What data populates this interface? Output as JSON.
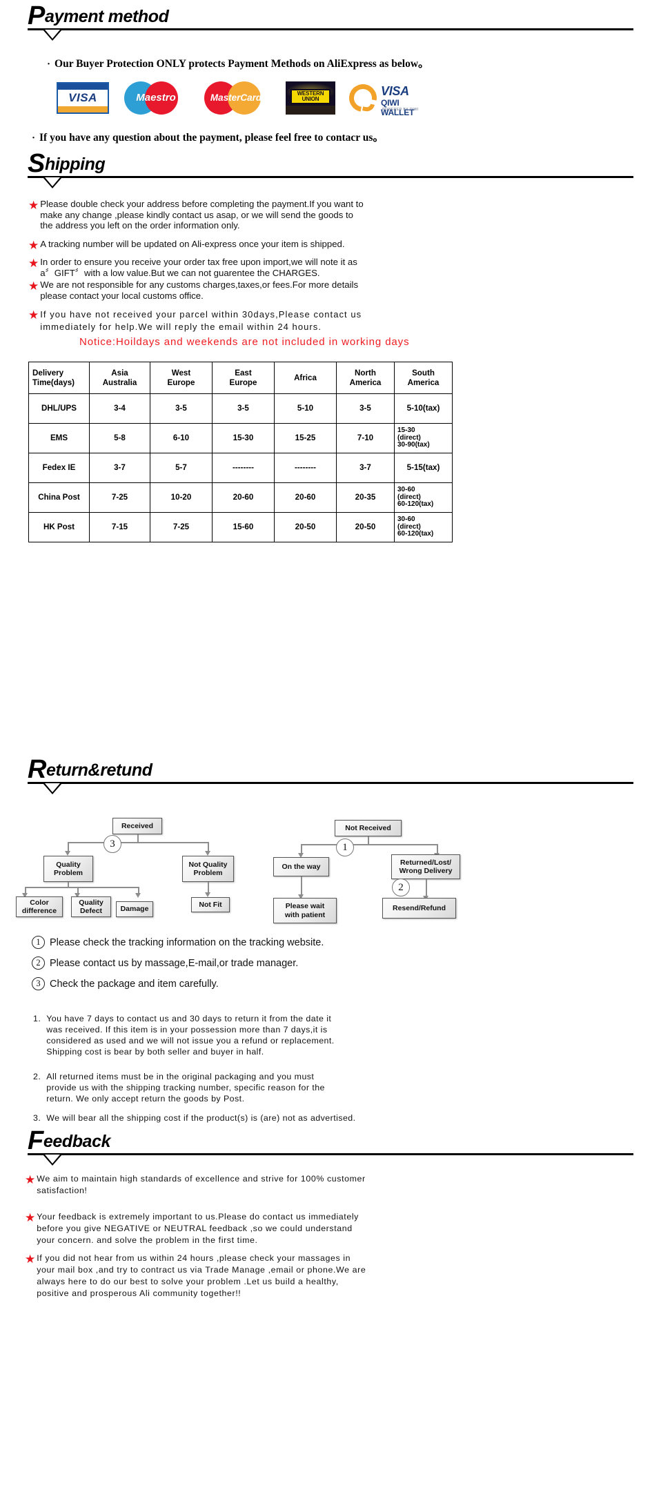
{
  "payment": {
    "heading_cap": "P",
    "heading_rest": "ayment method",
    "bullet_1": "Our Buyer Protection ONLY protects Payment Methods on AliExpress as below。",
    "bullet_2": "If you have any question about the payment, please feel free to contacr us。",
    "logos": [
      {
        "name": "visa-logo",
        "text": "VISA"
      },
      {
        "name": "maestro-logo",
        "text": "Maestro"
      },
      {
        "name": "mastercard-logo",
        "text": "MasterCard"
      },
      {
        "name": "western-union-logo",
        "line1": "WESTERN",
        "line2": "UNION"
      },
      {
        "name": "qiwi-wallet-logo",
        "visa": "VISA",
        "wallet": "QIWI WALLET",
        "powered": "POWERED BY QIWI"
      }
    ]
  },
  "shipping": {
    "heading_cap": "S",
    "heading_rest": "hipping",
    "bullets": [
      "Please double check your address before completing the payment.If you want to\nmake any change ,please kindly contact us asap, or we will send the goods to\nthe address you left on the order information only.",
      "A tracking number will be updated on Ali-express once your item is shipped.",
      "In order to ensure you receive your order tax free upon import,we will note it as\n a〞GIFT〞with a low value.But we can not guarentee the CHARGES.",
      "We are not responsible for any customs charges,taxes,or fees.For more details\n please contact your local customs office.",
      "If you have not received your parcel within 30days,Please contact us\nimmediately for help.We will reply the email within 24 hours."
    ],
    "notice": "Notice:Hoildays and weekends are not included in working days"
  },
  "shipping_table": {
    "headers": [
      "Delivery\nTime(days)",
      "Asia\nAustralia",
      "West\nEurope",
      "East\nEurope",
      "Africa",
      "North\nAmerica",
      "South\nAmerica"
    ],
    "rows": [
      {
        "method": "DHL/UPS",
        "cells": [
          "3-4",
          "3-5",
          "3-5",
          "5-10",
          "3-5",
          "5-10(tax)"
        ],
        "last_small": false
      },
      {
        "method": "EMS",
        "cells": [
          "5-8",
          "6-10",
          "15-30",
          "15-25",
          "7-10",
          "15-30\n(direct)\n30-90(tax)"
        ],
        "last_small": true
      },
      {
        "method": "Fedex IE",
        "cells": [
          "3-7",
          "5-7",
          "--------",
          "--------",
          "3-7",
          "5-15(tax)"
        ],
        "last_small": false
      },
      {
        "method": "China Post",
        "cells": [
          "7-25",
          "10-20",
          "20-60",
          "20-60",
          "20-35",
          "30-60\n(direct)\n60-120(tax)"
        ],
        "last_small": true
      },
      {
        "method": "HK Post",
        "cells": [
          "7-15",
          "7-25",
          "15-60",
          "20-50",
          "20-50",
          "30-60\n(direct)\n60-120(tax)"
        ],
        "last_small": true
      }
    ]
  },
  "returns": {
    "heading_cap": "R",
    "heading_rest": "eturn&retund",
    "flow_left": {
      "root": "Received",
      "badge": "3",
      "left_branch": "Quality\nProblem",
      "right_branch": "Not Quality\nProblem",
      "leaves": [
        "Color\ndifference",
        "Quality\nDefect",
        "Damage"
      ],
      "right_leaf": "Not Fit"
    },
    "flow_right": {
      "root": "Not  Received",
      "badge_top": "1",
      "badge_bottom": "2",
      "left_branch": "On the way",
      "right_branch": "Returned/Lost/\nWrong Delivery",
      "left_leaf": "Please wait\nwith patient",
      "right_leaf": "Resend/Refund"
    },
    "notes": [
      {
        "num": "1",
        "text": "Please check the tracking information on the tracking website."
      },
      {
        "num": "2",
        "text": "Please contact us by  massage,E-mail,or trade manager."
      },
      {
        "num": "3",
        "text": "Check the package and item carefully."
      }
    ],
    "terms": [
      {
        "idx": "1.",
        "text": "You have 7 days to contact us and 30 days to return it from the date it\nwas received. If this item is in your possession more than 7 days,it is\nconsidered as used and we will not issue you a refund or replacement.\nShipping cost is bear by both seller and buyer in half."
      },
      {
        "idx": "2.",
        "text": "All returned items must be in the original packaging and you must\nprovide us with the shipping tracking number, specific reason for the\nreturn. We only accept return the goods by Post."
      },
      {
        "idx": "3.",
        "text": "We will bear all the shipping cost if the product(s) is (are) not as advertised."
      }
    ]
  },
  "feedback": {
    "heading_cap": "F",
    "heading_rest": "eedback",
    "items": [
      "We aim to  maintain high standards of excellence and strive  for 100% customer\nsatisfaction!",
      "Your feedback is extremely important to us.Please do contact us immediately\nbefore you give NEGATIVE or NEUTRAL feedback ,so  we could understand\nyour concern. and solve the problem in the first time.",
      "If you did not hear from us within 24 hours ,please check your massages in\nyour mail box ,and  try to contract us via Trade Manage ,email or phone.We are\nalways here to do our best to solve your problem .Let us build a healthy,\npositive and prosperous Ali community together!!"
    ]
  }
}
